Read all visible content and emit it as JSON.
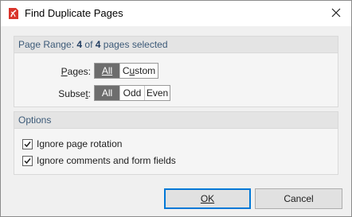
{
  "window": {
    "title": "Find Duplicate Pages",
    "close_glyph": "✕"
  },
  "page_range": {
    "prefix": "Page Range: ",
    "selected": "4",
    "of": " of ",
    "total": "4",
    "suffix": " pages selected",
    "pages_label": "Pages:",
    "pages_options": [
      {
        "label": "All",
        "selected": true
      },
      {
        "label": "Custom",
        "selected": false
      }
    ],
    "subset_label": "Subset:",
    "subset_options": [
      {
        "label": "All",
        "selected": true
      },
      {
        "label": "Odd",
        "selected": false
      },
      {
        "label": "Even",
        "selected": false
      }
    ]
  },
  "options": {
    "title": "Options",
    "ignore_rotation": {
      "label": "Ignore page rotation",
      "checked": true
    },
    "ignore_comments": {
      "label": "Ignore comments and form fields",
      "checked": true
    }
  },
  "buttons": {
    "ok": "OK",
    "cancel": "Cancel"
  },
  "colors": {
    "accent": "#0078d7",
    "segment_active": "#6d6d6d",
    "app_icon": "#d9342b"
  }
}
